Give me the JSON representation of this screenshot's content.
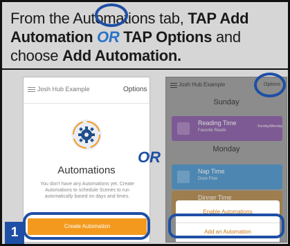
{
  "instruction": {
    "part1": "From the Automations tab, ",
    "bold1": "TAP Add Automation",
    "or": "OR",
    "bold2": "TAP Options",
    "part2": " and choose ",
    "bold3": "Add Automation."
  },
  "step_number": "1",
  "or_label": "OR",
  "left_screen": {
    "app_title": "Josh Hub Example",
    "options_label": "Options",
    "heading": "Automations",
    "description": "You don't have any Automations yet. Create Automations to schedule Scenes to run automatically based on days and times.",
    "button_label": "Create Automation",
    "accent_color": "#f39a1e"
  },
  "right_screen": {
    "app_title": "Josh Hub Example",
    "options_label": "Options",
    "days": [
      "Sunday",
      "Monday"
    ],
    "cards": [
      {
        "title": "Reading Time",
        "subtitle": "Favorite Reads",
        "right": "Sunday/Monday"
      },
      {
        "title": "Nap Time",
        "subtitle": "Doze Flow",
        "right": ""
      },
      {
        "title": "Dinner Time",
        "subtitle": "",
        "right": ""
      }
    ],
    "sheet": {
      "enable_label": "Enable Automations",
      "add_label": "Add an Automation"
    }
  },
  "highlight_color": "#1e4fa5"
}
